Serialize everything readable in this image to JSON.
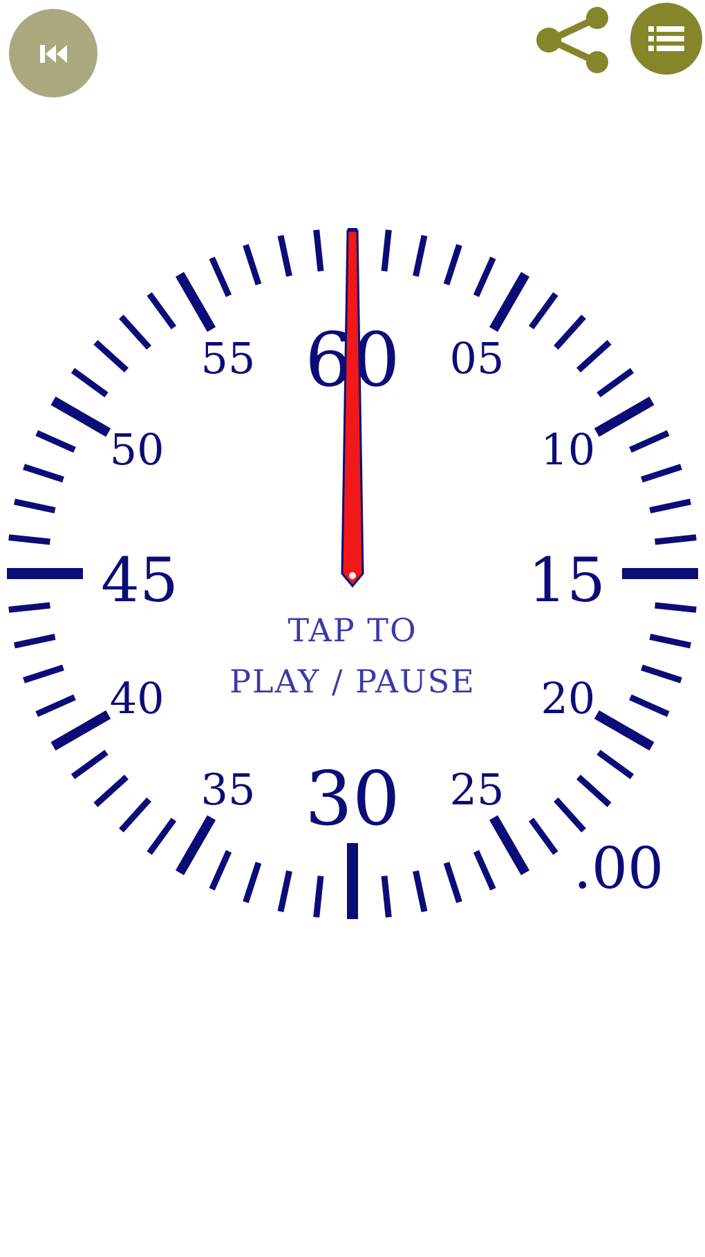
{
  "toolbar": {
    "reset_icon": "skip-back-icon",
    "share_icon": "share-icon",
    "menu_icon": "list-menu-icon"
  },
  "colors": {
    "button_olive": "#85852a",
    "button_faded": "#a9a87e",
    "dial_navy": "#0c0c78",
    "hand_red": "#f01818",
    "background": "#ffffff"
  },
  "dial": {
    "major_labels": {
      "top": "60",
      "right": "15",
      "bottom": "30",
      "left": "45"
    },
    "minor_labels": [
      "05",
      "10",
      "20",
      "25",
      "35",
      "40",
      "50",
      "55"
    ],
    "readout": ".00",
    "hint_line1": "TAP TO",
    "hint_line2": "PLAY / PAUSE"
  },
  "hand": {
    "seconds": 0
  }
}
